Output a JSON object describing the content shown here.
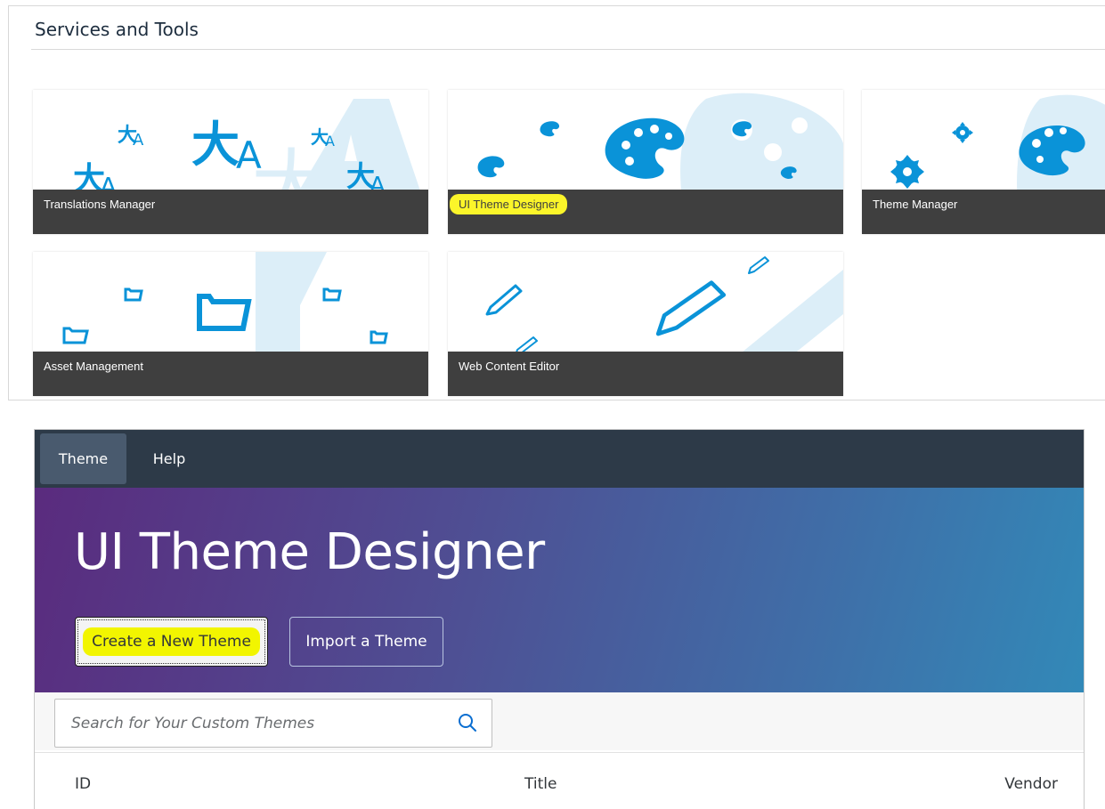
{
  "services": {
    "title": "Services and Tools",
    "tiles": [
      {
        "label": "Translations Manager"
      },
      {
        "label": "UI Theme Designer",
        "highlighted": true
      },
      {
        "label": "Theme Manager"
      },
      {
        "label": "Asset Management"
      },
      {
        "label": "Web Content Editor"
      }
    ]
  },
  "designer": {
    "menu": [
      {
        "label": "Theme",
        "selected": true
      },
      {
        "label": "Help"
      }
    ],
    "hero_title": "UI Theme Designer",
    "buttons": {
      "create": "Create a New Theme",
      "import": "Import a Theme"
    },
    "search": {
      "placeholder": "Search for Your Custom Themes",
      "value": ""
    },
    "table": {
      "columns": [
        "ID",
        "Title",
        "Vendor"
      ]
    }
  },
  "colors": {
    "icon_blue": "#0a93d8",
    "tile_label_bg": "#3f3f3f",
    "highlight": "#fbf52a",
    "shell_bar": "#2d3a48",
    "hero_gradient_start": "#5a2b7e",
    "hero_gradient_end": "#3289b8"
  }
}
